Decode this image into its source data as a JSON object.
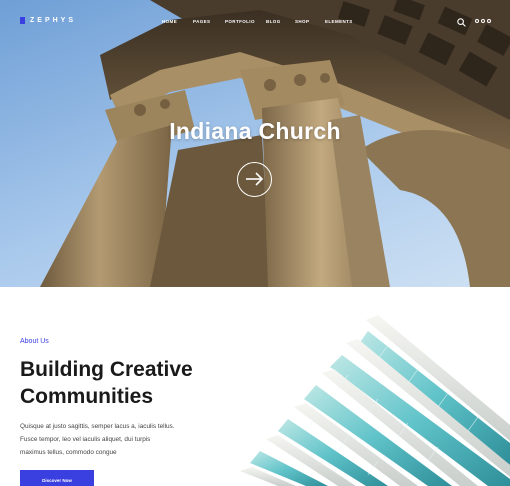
{
  "brand": {
    "name": "ZEPHYS",
    "accent": "#3a3fe0"
  },
  "nav": {
    "items": [
      {
        "label": "HOME"
      },
      {
        "label": "PAGES"
      },
      {
        "label": "PORTFOLIO"
      },
      {
        "label": "BLOG"
      },
      {
        "label": "SHOP"
      },
      {
        "label": "ELEMENTS"
      }
    ],
    "icons": [
      "search-icon",
      "menu-dots-icon"
    ]
  },
  "hero": {
    "title": "Indiana Church",
    "action_icon": "arrow-right-icon"
  },
  "about": {
    "label": "About Us",
    "title_line1": "Building Creative",
    "title_line2": "Communities",
    "text_line1": "Quisque at justo sagittis, semper lacus a, iaculis tellus.",
    "text_line2": "Fusce tempor, leo vel iaculis aliquet, dui turpis",
    "text_line3": "maximus tellus, commodo congue",
    "button_label": "Discover Now"
  }
}
